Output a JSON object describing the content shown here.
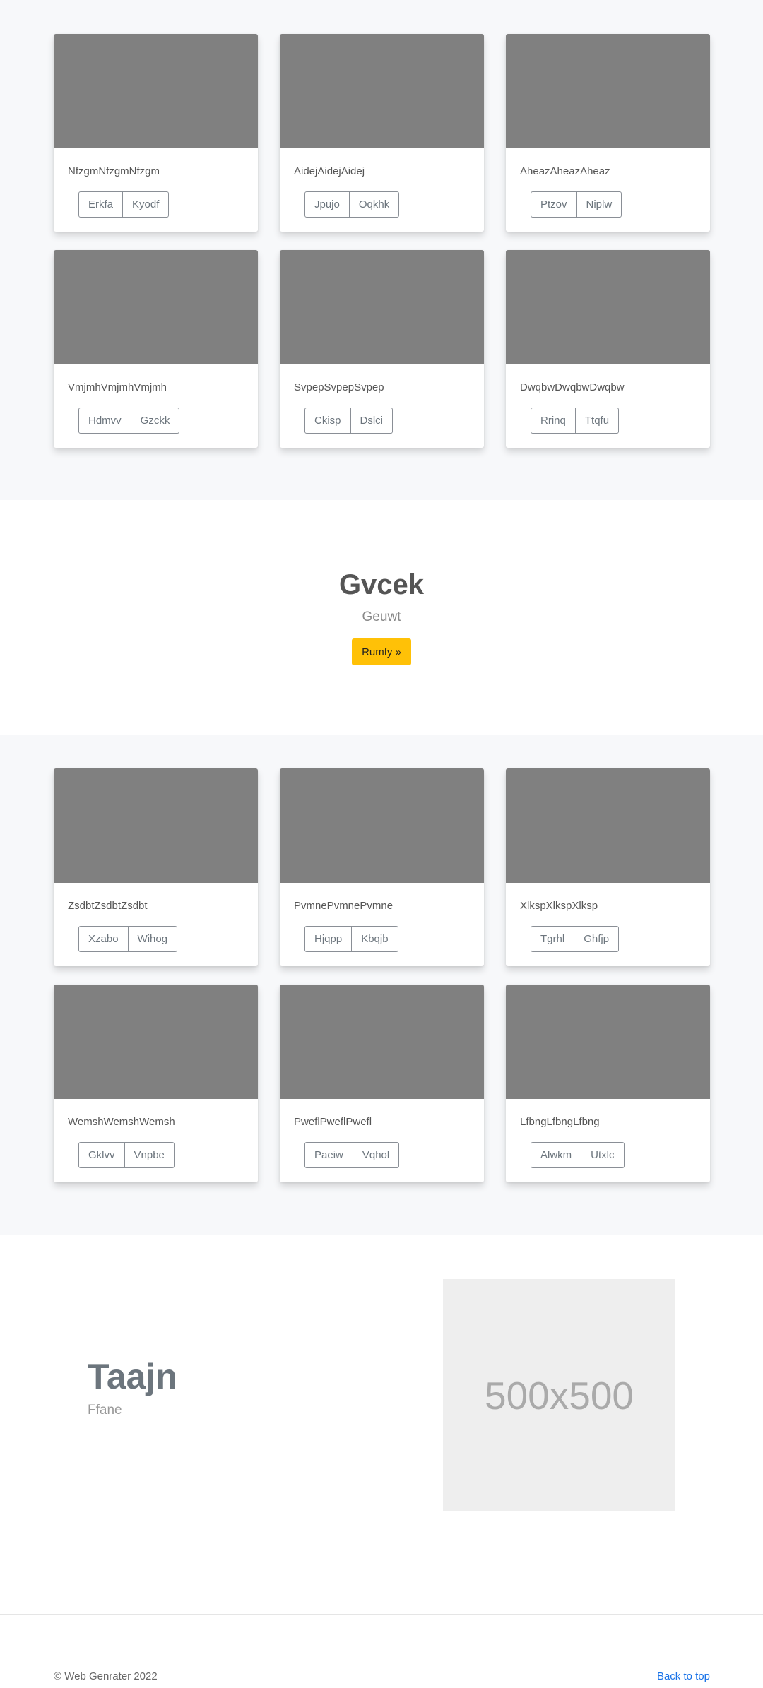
{
  "album_top": {
    "cards": [
      {
        "title": "NfzgmNfzgmNfzgm",
        "buttons": [
          "Erkfa",
          "Kyodf"
        ]
      },
      {
        "title": "AidejAidejAidej",
        "buttons": [
          "Jpujo",
          "Oqkhk"
        ]
      },
      {
        "title": "AheazAheazAheaz",
        "buttons": [
          "Ptzov",
          "Niplw"
        ]
      },
      {
        "title": "VmjmhVmjmhVmjmh",
        "buttons": [
          "Hdmvv",
          "Gzckk"
        ]
      },
      {
        "title": "SvpepSvpepSvpep",
        "buttons": [
          "Ckisp",
          "Dslci"
        ]
      },
      {
        "title": "DwqbwDwqbwDwqbw",
        "buttons": [
          "Rrinq",
          "Ttqfu"
        ]
      }
    ]
  },
  "hero": {
    "title": "Gvcek",
    "subtitle": "Geuwt",
    "button_label": "Rumfy »",
    "button_color": "#ffc107"
  },
  "album_bottom": {
    "cards": [
      {
        "title": "ZsdbtZsdbtZsdbt",
        "buttons": [
          "Xzabo",
          "Wihog"
        ]
      },
      {
        "title": "PvmnePvmnePvmne",
        "buttons": [
          "Hjqpp",
          "Kbqjb"
        ]
      },
      {
        "title": "XlkspXlkspXlksp",
        "buttons": [
          "Tgrhl",
          "Ghfjp"
        ]
      },
      {
        "title": "WemshWemshWemsh",
        "buttons": [
          "Gklvv",
          "Vnpbe"
        ]
      },
      {
        "title": "PweflPweflPwefl",
        "buttons": [
          "Paeiw",
          "Vqhol"
        ]
      },
      {
        "title": "LfbngLfbngLfbng",
        "buttons": [
          "Alwkm",
          "Utxlc"
        ]
      }
    ]
  },
  "feature": {
    "title": "Taajn",
    "subtitle": "Ffane",
    "placeholder_text": "500x500"
  },
  "footer": {
    "copyright": "© Web Genrater 2022",
    "back_to_top": "Back to top",
    "link_color": "#1a73e8"
  }
}
